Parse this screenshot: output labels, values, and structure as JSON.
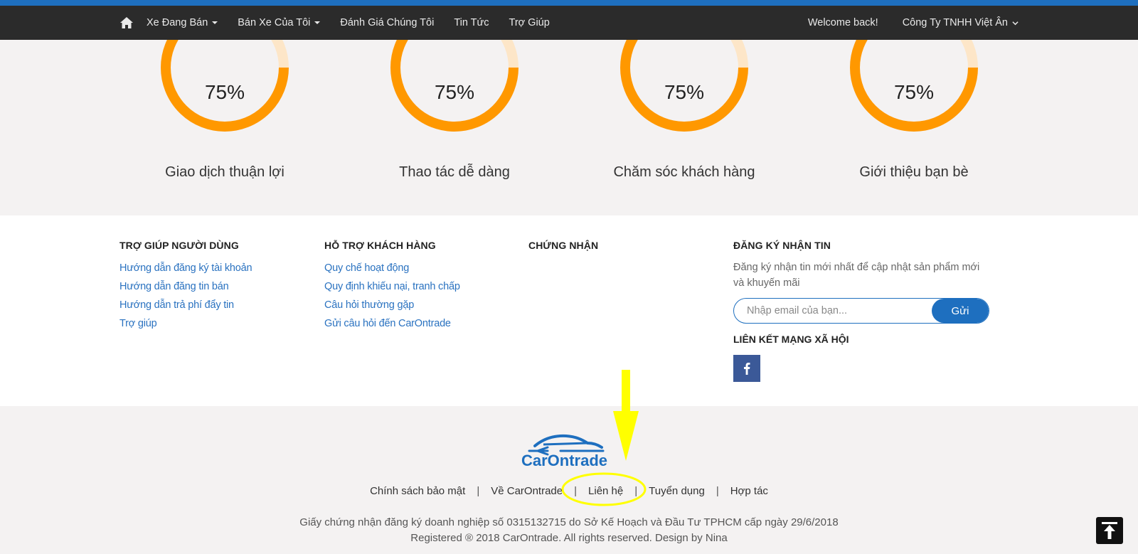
{
  "nav": {
    "home_icon": "home-icon",
    "items": [
      {
        "label": "Xe Đang Bán",
        "dropdown": true
      },
      {
        "label": "Bán Xe Của Tôi",
        "dropdown": true
      },
      {
        "label": "Đánh Giá Chúng Tôi",
        "dropdown": false
      },
      {
        "label": "Tin Tức",
        "dropdown": false
      },
      {
        "label": "Trợ Giúp",
        "dropdown": false
      }
    ],
    "welcome": "Welcome back!",
    "company": "Công Ty TNHH Việt Ân"
  },
  "stats": [
    {
      "value": "75%",
      "fraction": 0.75,
      "title": "Giao dịch thuận lợi"
    },
    {
      "value": "75%",
      "fraction": 0.75,
      "title": "Thao tác dễ dàng"
    },
    {
      "value": "75%",
      "fraction": 0.75,
      "title": "Chăm sóc khách hàng"
    },
    {
      "value": "75%",
      "fraction": 0.75,
      "title": "Giới thiệu bạn bè"
    }
  ],
  "footer": {
    "col1": {
      "title": "TRỢ GIÚP NGƯỜI DÙNG",
      "links": [
        "Hướng dẫn đăng ký tài khoản",
        "Hướng dẫn đăng tin bán",
        "Hướng dẫn trả phí đẩy tin",
        "Trợ giúp"
      ]
    },
    "col2": {
      "title": "HỖ TRỢ KHÁCH HÀNG",
      "links": [
        "Quy chế hoạt động",
        "Quy định khiếu nại, tranh chấp",
        "Câu hỏi thường gặp",
        "Gửi câu hỏi đến CarOntrade"
      ]
    },
    "col3": {
      "title": "CHỨNG NHẬN"
    },
    "col4": {
      "title": "ĐĂNG KÝ NHẬN TIN",
      "text": "Đăng ký nhận tin mới nhất để cập nhật sản phẩm mới và khuyến mãi",
      "placeholder": "Nhập email của bạn...",
      "button": "Gửi",
      "social_title": "LIÊN KẾT MẠNG XÃ HỘI",
      "social_icon": "facebook-icon"
    }
  },
  "bottom": {
    "logo_text": "CarOntrade",
    "links": [
      "Chính sách bảo mật",
      "Về CarOntrade",
      "Liên hệ",
      "Tuyển dụng",
      "Hợp tác"
    ],
    "separator": "|",
    "cert": "Giấy chứng nhận đăng ký doanh nghiệp số 0315132715 do Sở Kế Hoạch và Đầu Tư TPHCM cấp ngày 29/6/2018",
    "copyright": "Registered ® 2018 CarOntrade. All rights reserved. Design by Nina"
  },
  "colors": {
    "accent": "#1e6fbf",
    "ring": "#ff9800",
    "ring_track": "#fde6c8",
    "annotation": "#ffff00"
  }
}
